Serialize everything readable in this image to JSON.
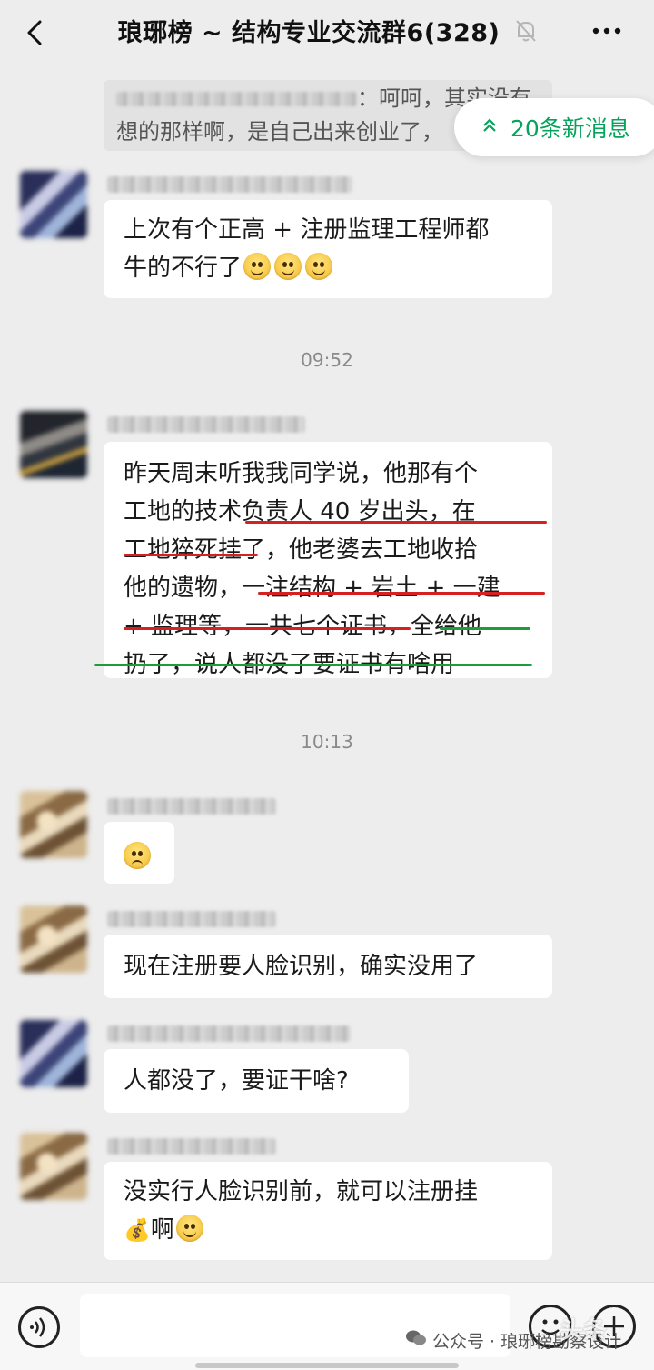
{
  "header": {
    "title": "琅琊榜 ~ 结构专业交流群6(328)"
  },
  "quote": {
    "text_line1": "：呵呵，其实没有",
    "text_line2": "想的那样啊，是自己出来创业了，"
  },
  "new_messages": {
    "label": "20条新消息"
  },
  "messages": [
    {
      "lines": [
        "上次有个正高 + 注册监理工程师都",
        "牛的不行了"
      ]
    },
    {
      "time": "09:52"
    },
    {
      "lines": [
        "昨天周末听我我同学说，他那有个",
        "工地的技术负责人 40 岁出头，在",
        "工地猝死挂了，他老婆去工地收拾",
        "他的遗物，一注结构 + 岩土 + 一建",
        "+ 监理等，一共七个证书，全给他",
        "扔了，说人都没了要证书有啥用"
      ]
    },
    {
      "time": "10:13"
    },
    {
      "lines": [
        ""
      ]
    },
    {
      "lines": [
        "现在注册要人脸识别，确实没用了"
      ]
    },
    {
      "lines": [
        "人都没了，要证干啥?"
      ]
    },
    {
      "lines": [
        "没实行人脸识别前，就可以注册挂",
        "啊"
      ]
    }
  ],
  "footer": {
    "watermark": "公众号 · 琅琊榜勘察设计",
    "watermark_overlay": "头条"
  },
  "colors": {
    "accent_green": "#07a35c",
    "underline_red": "#d42222",
    "underline_green": "#1e9c3a",
    "bubble": "#ffffff",
    "background": "#ededed"
  },
  "icons": [
    "back-arrow-icon",
    "muted-bell-icon",
    "more-icon",
    "double-chevron-up-icon",
    "voice-icon",
    "emoji-icon",
    "plus-icon",
    "wechat-icon"
  ]
}
